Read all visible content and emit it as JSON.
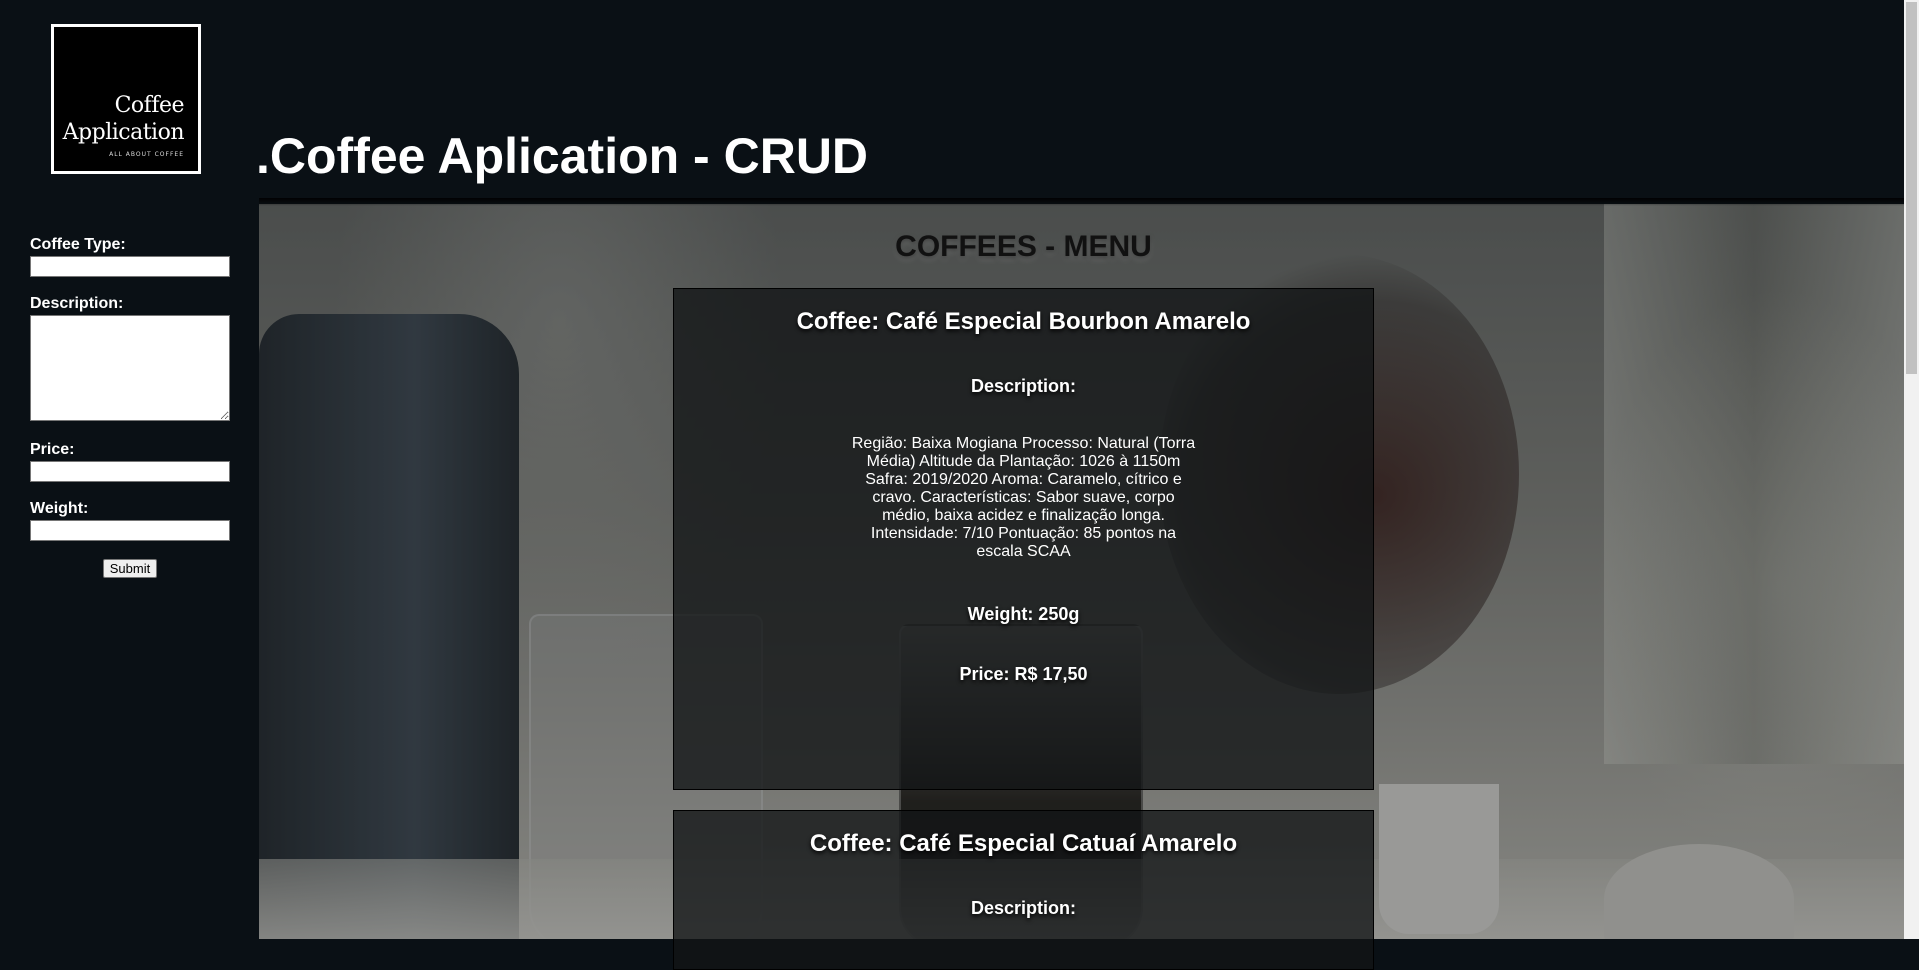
{
  "logo": {
    "line1": "Coffee",
    "line2": "Application",
    "tagline": "ALL ABOUT COFFEE"
  },
  "header": {
    "title": ".Coffee Aplication - CRUD"
  },
  "form": {
    "coffee_type_label": "Coffee Type:",
    "coffee_type_value": "",
    "description_label": "Description:",
    "description_value": "",
    "price_label": "Price:",
    "price_value": "",
    "weight_label": "Weight:",
    "weight_value": "",
    "submit_label": "Submit"
  },
  "menu": {
    "heading": "COFFEES - MENU",
    "coffees": [
      {
        "name": "Coffee: Café Especial Bourbon Amarelo",
        "description_label": "Description:",
        "description": "Região: Baixa Mogiana Processo: Natural (Torra Média) Altitude da Plantação: 1026 à 1150m Safra: 2019/2020 Aroma: Caramelo, cítrico e cravo. Características: Sabor suave, corpo médio, baixa acidez e finalização longa. Intensidade: 7/10 Pontuação: 85 pontos na escala SCAA",
        "weight": "Weight: 250g",
        "price": "Price: R$ 17,50"
      },
      {
        "name": "Coffee: Café Especial Catuaí Amarelo",
        "description_label": "Description:"
      }
    ]
  }
}
